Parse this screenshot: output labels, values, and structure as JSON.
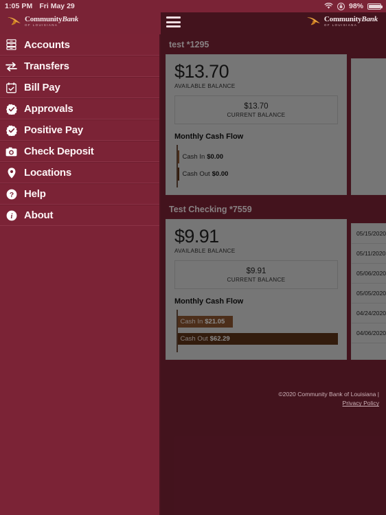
{
  "status_bar": {
    "time": "1:05 PM",
    "date": "Fri May 29",
    "battery_pct": "98%",
    "wifi_icon": "wifi-icon",
    "orientation_lock_icon": "rotation-lock-icon",
    "battery_icon": "battery-icon"
  },
  "brand": {
    "name_part1": "Community",
    "name_part2": "Bank",
    "tagline": "OF LOUISIANA",
    "bird_icon": "eagle-logo-icon",
    "menu_icon": "hamburger-menu-icon",
    "accent_maroon": "#7b2336",
    "accent_dark": "#4a1420"
  },
  "sidebar": {
    "items": [
      {
        "label": "Accounts",
        "icon": "accounts-icon"
      },
      {
        "label": "Transfers",
        "icon": "transfers-icon"
      },
      {
        "label": "Bill Pay",
        "icon": "calendar-check-icon"
      },
      {
        "label": "Approvals",
        "icon": "check-badge-icon"
      },
      {
        "label": "Positive Pay",
        "icon": "check-badge-icon"
      },
      {
        "label": "Check Deposit",
        "icon": "camera-icon"
      },
      {
        "label": "Locations",
        "icon": "map-pin-icon"
      },
      {
        "label": "Help",
        "icon": "question-circle-icon"
      },
      {
        "label": "About",
        "icon": "info-circle-icon"
      }
    ]
  },
  "accounts": [
    {
      "title": "test *1295",
      "available_balance": "$13.70",
      "available_label": "AVAILABLE BALANCE",
      "current_balance": "$13.70",
      "current_label": "CURRENT BALANCE",
      "cash_flow_title": "Monthly Cash Flow",
      "cash_in_label": "Cash In",
      "cash_in_value": "$0.00",
      "cash_out_label": "Cash Out",
      "cash_out_value": "$0.00",
      "transactions": []
    },
    {
      "title": "Test Checking *7559",
      "available_balance": "$9.91",
      "available_label": "AVAILABLE BALANCE",
      "current_balance": "$9.91",
      "current_label": "CURRENT BALANCE",
      "cash_flow_title": "Monthly Cash Flow",
      "cash_in_label": "Cash In",
      "cash_in_value": "$21.05",
      "cash_out_label": "Cash Out",
      "cash_out_value": "$62.29",
      "transactions": [
        {
          "date": "05/15/2020"
        },
        {
          "date": "05/11/2020"
        },
        {
          "date": "05/06/2020"
        },
        {
          "date": "05/05/2020"
        },
        {
          "date": "04/24/2020"
        },
        {
          "date": "04/06/2020"
        }
      ]
    }
  ],
  "chart_data": [
    {
      "type": "bar",
      "title": "Monthly Cash Flow",
      "categories": [
        "Cash In",
        "Cash Out"
      ],
      "values": [
        0.0,
        0.0
      ],
      "value_labels": [
        "$0.00",
        "$0.00"
      ],
      "xlabel": "",
      "ylabel": "",
      "xlim": [
        0,
        62.29
      ],
      "orientation": "horizontal",
      "grid": false,
      "legend": "none",
      "colors": [
        "#8a5430",
        "#5e3318"
      ],
      "account": "test *1295"
    },
    {
      "type": "bar",
      "title": "Monthly Cash Flow",
      "categories": [
        "Cash In",
        "Cash Out"
      ],
      "values": [
        21.05,
        62.29
      ],
      "value_labels": [
        "$21.05",
        "$62.29"
      ],
      "xlabel": "",
      "ylabel": "",
      "xlim": [
        0,
        62.29
      ],
      "orientation": "horizontal",
      "grid": false,
      "legend": "none",
      "colors": [
        "#8a5430",
        "#5e3318"
      ],
      "account": "Test Checking *7559"
    }
  ],
  "footer": {
    "copyright": "©2020 Community Bank of Louisiana |",
    "privacy_link": "Privacy Policy"
  }
}
